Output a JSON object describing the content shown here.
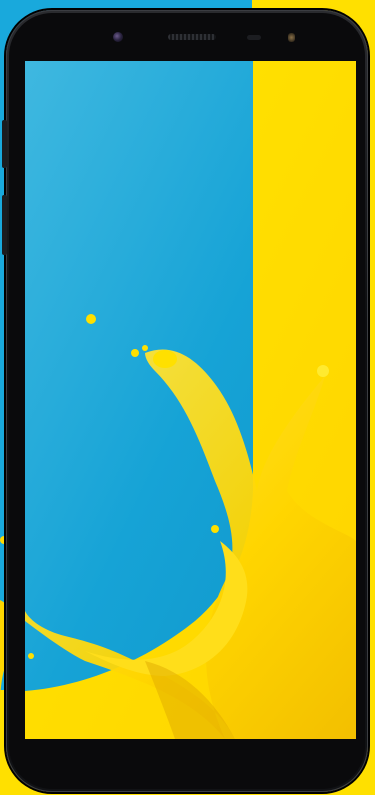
{
  "scene": {
    "subject": "smartphone-front",
    "colors": {
      "background_blue": "#19a9dc",
      "background_yellow": "#ffe000",
      "screen_blue": "#12a2d6",
      "screen_yellow": "#ffe100",
      "phone_body": "#111215"
    },
    "icons": [
      "front-camera-icon",
      "earpiece-grille",
      "proximity-sensor",
      "front-flash-icon"
    ]
  }
}
